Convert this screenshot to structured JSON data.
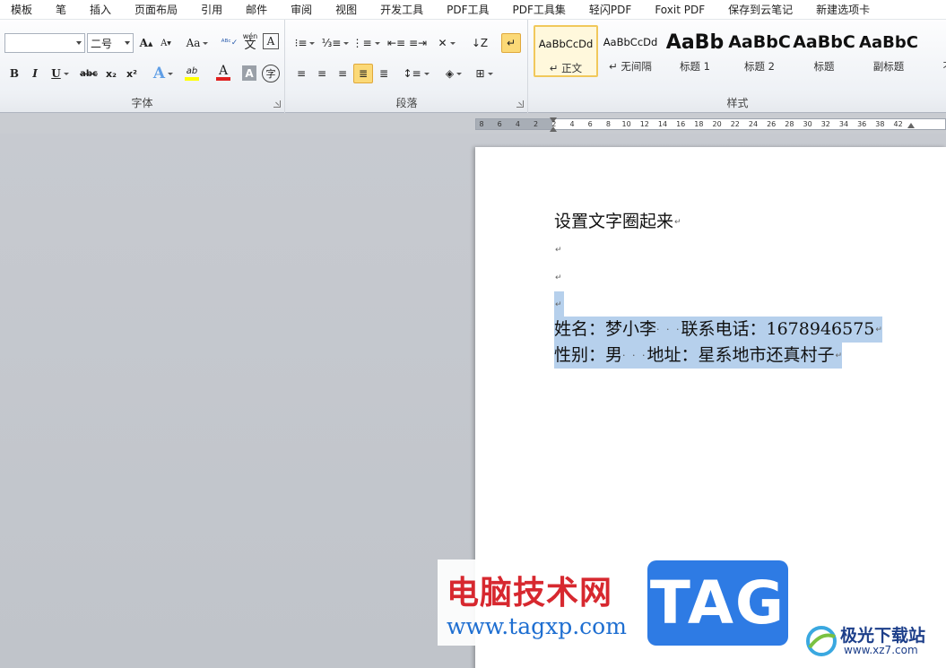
{
  "menu": {
    "tabs": [
      "模板",
      "笔",
      "插入",
      "页面布局",
      "引用",
      "邮件",
      "审阅",
      "视图",
      "开发工具",
      "PDF工具",
      "PDF工具集",
      "轻闪PDF",
      "Foxit PDF",
      "保存到云笔记",
      "新建选项卡"
    ]
  },
  "ribbon": {
    "font_group": {
      "label": "字体",
      "font_name": "",
      "font_size": "二号",
      "grow_font": "A",
      "shrink_font": "A",
      "change_case": "Aa",
      "phonetic": "wén",
      "phonetic_char": "文",
      "char_border": "A",
      "bold": "B",
      "italic": "I",
      "underline": "U",
      "strikethrough": "abc",
      "subscript": "x₂",
      "superscript": "x²",
      "text_effects": "A",
      "highlight": "ab",
      "font_color": "A",
      "char_shading": "A",
      "enclose_char": "字"
    },
    "paragraph_group": {
      "label": "段落"
    },
    "styles_group": {
      "label": "样式",
      "styles": [
        {
          "sample": "AaBbCcDd",
          "name": "↵ 正文"
        },
        {
          "sample": "AaBbCcDd",
          "name": "↵ 无间隔"
        },
        {
          "sample": "AaBb",
          "name": "标题 1"
        },
        {
          "sample": "AaBbC",
          "name": "标题 2"
        },
        {
          "sample": "AaBbC",
          "name": "标题"
        },
        {
          "sample": "AaBbC",
          "name": "副标题"
        },
        {
          "sample": "",
          "name": "不明"
        }
      ]
    }
  },
  "ruler": {
    "ticks": [
      "8",
      "6",
      "4",
      "2",
      "2",
      "4",
      "6",
      "8",
      "10",
      "12",
      "14",
      "16",
      "18",
      "20",
      "22",
      "24",
      "26",
      "28",
      "30",
      "32",
      "34",
      "36",
      "38",
      "42"
    ]
  },
  "document": {
    "title_line": "设置文字圈起来",
    "paragraph_mark": "↵",
    "line1_name_label": "姓名：梦小李",
    "line1_phone_label": "联系电话：1678946575",
    "line2_gender_label": "性别：男",
    "line2_address_label": "地址：星系地市还真村子",
    "space_dots": "· · ·"
  },
  "watermark": {
    "title": "电脑技术网",
    "url": "www.tagxp.com",
    "badge": "TAG",
    "site_name": "极光下载站",
    "site_domain": "www.xz7.com"
  }
}
